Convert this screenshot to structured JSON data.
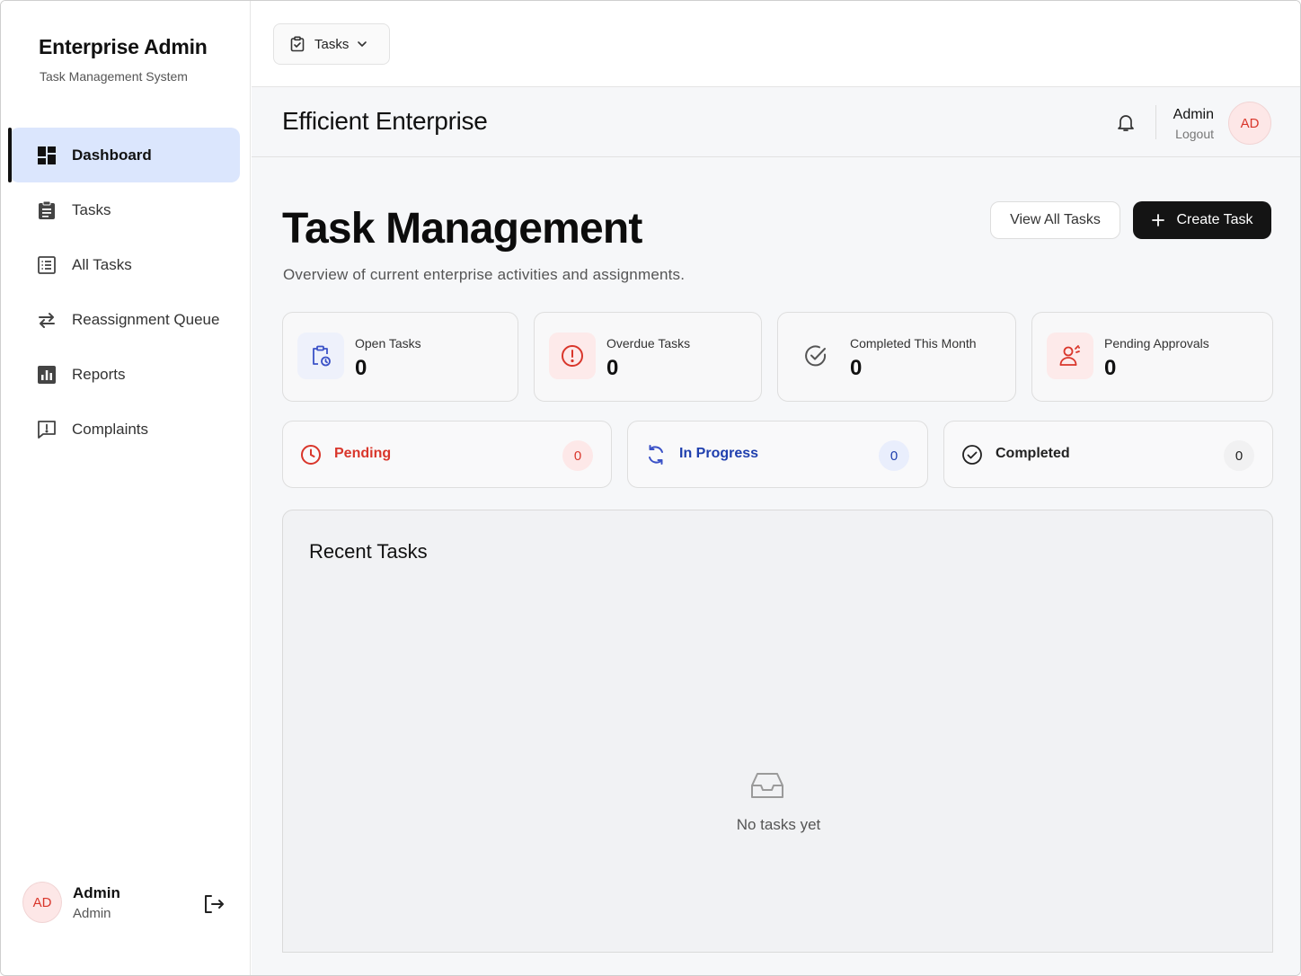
{
  "sidebar": {
    "brand_title": "Enterprise Admin",
    "brand_subtitle": "Task Management System",
    "items": [
      {
        "label": "Dashboard",
        "icon": "dashboard-icon",
        "active": true
      },
      {
        "label": "Tasks",
        "icon": "clipboard-icon"
      },
      {
        "label": "All Tasks",
        "icon": "list-icon"
      },
      {
        "label": "Reassignment Queue",
        "icon": "swap-icon"
      },
      {
        "label": "Reports",
        "icon": "bar-chart-icon"
      },
      {
        "label": "Complaints",
        "icon": "feedback-icon"
      }
    ],
    "user": {
      "initials": "AD",
      "name": "Admin",
      "role": "Admin"
    }
  },
  "topbar": {
    "dropdown_label": "Tasks"
  },
  "header": {
    "org_title": "Efficient Enterprise",
    "user_name": "Admin",
    "logout_label": "Logout",
    "avatar_initials": "AD"
  },
  "main": {
    "title": "Task Management",
    "subtitle": "Overview of current enterprise activities and assignments.",
    "view_all_label": "View All Tasks",
    "create_label": "Create Task",
    "stats": [
      {
        "label": "Open Tasks",
        "value": "0"
      },
      {
        "label": "Overdue Tasks",
        "value": "0"
      },
      {
        "label": "Completed This Month",
        "value": "0"
      },
      {
        "label": "Pending Approvals",
        "value": "0"
      }
    ],
    "statuses": [
      {
        "label": "Pending",
        "count": "0"
      },
      {
        "label": "In Progress",
        "count": "0"
      },
      {
        "label": "Completed",
        "count": "0"
      }
    ],
    "recent": {
      "title": "Recent Tasks",
      "empty_text": "No tasks yet"
    }
  },
  "colors": {
    "accent_blue": "#dbe6fd",
    "pending_red": "#d9362b",
    "progress_blue": "#1f3fae",
    "primary_dark": "#141414"
  }
}
